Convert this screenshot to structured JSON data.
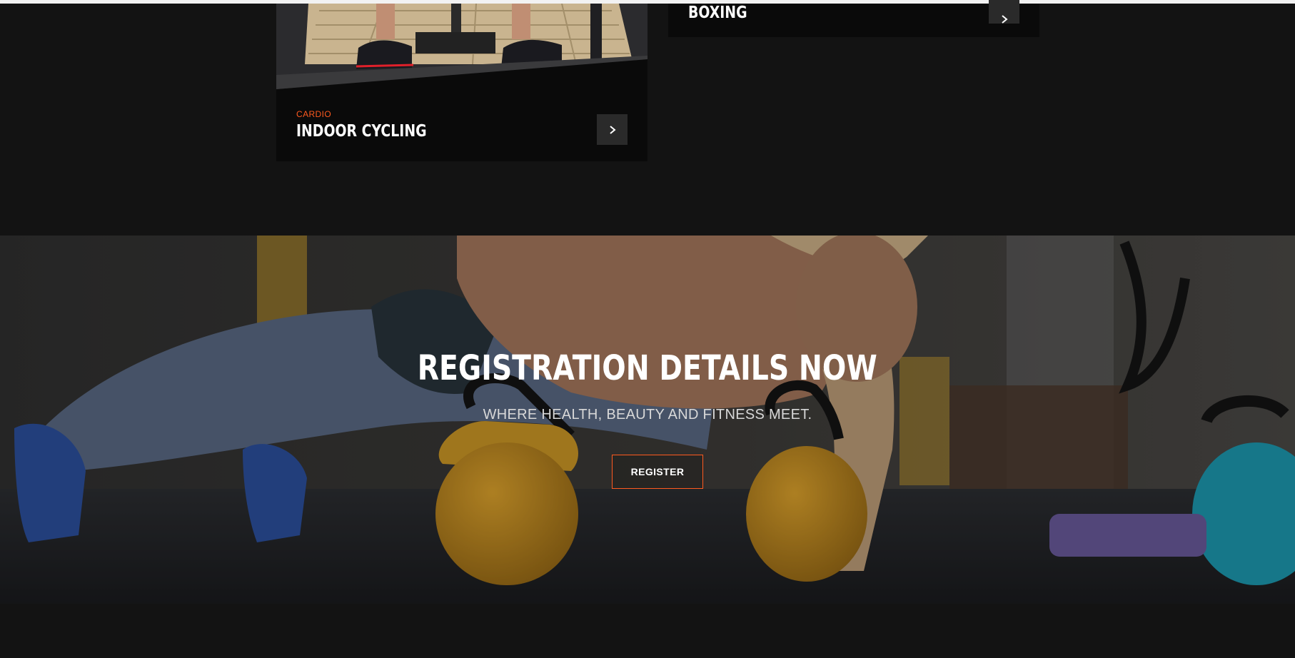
{
  "classes": [
    {
      "category": "CARDIO",
      "title": "INDOOR CYCLING",
      "action_icon": "chevron-right-icon"
    },
    {
      "category": "",
      "title": "BOXING",
      "action_icon": "chevron-right-icon"
    }
  ],
  "banner": {
    "title": "REGISTRATION DETAILS NOW",
    "subtitle": "WHERE HEALTH, BEAUTY AND FITNESS MEET.",
    "button_label": "REGISTER"
  },
  "colors": {
    "page_background": "#131313",
    "card_background": "#0a0a0a",
    "accent": "#ff5a1f",
    "text": "#ffffff",
    "arrow_button": "#2a2a2a"
  }
}
